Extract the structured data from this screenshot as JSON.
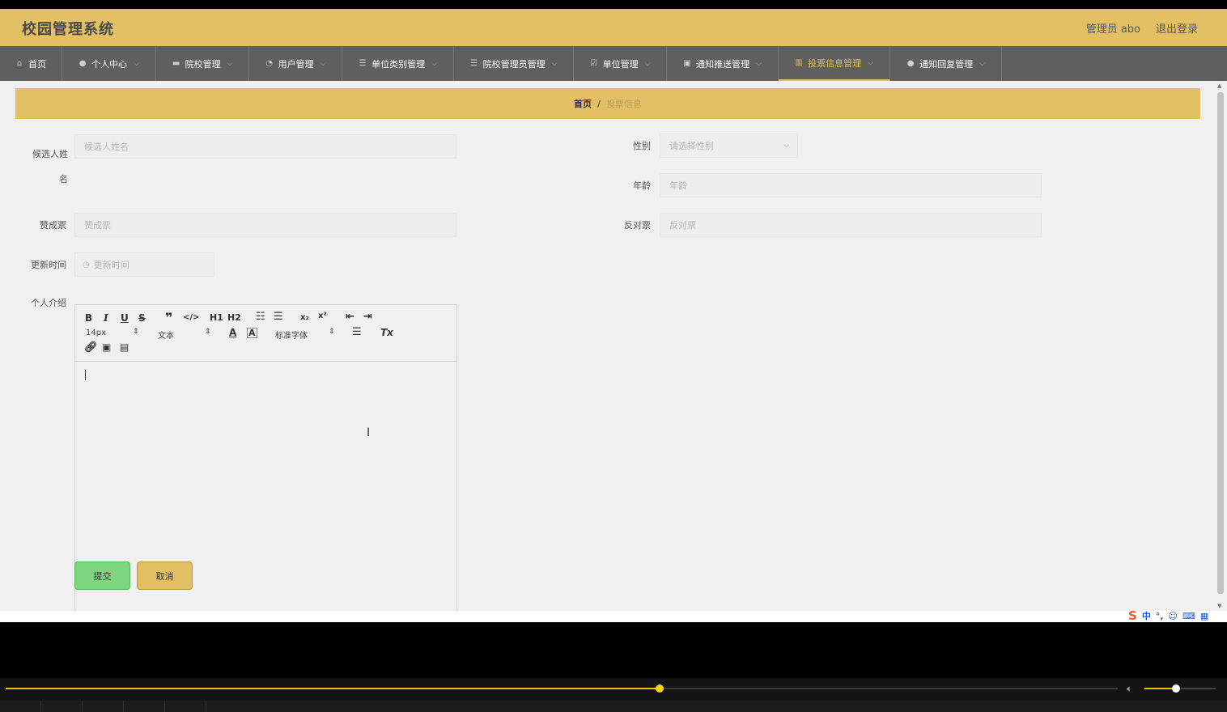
{
  "header": {
    "title": "校园管理系统",
    "user": "管理员 abo",
    "logout": "退出登录"
  },
  "nav": [
    {
      "label": "首页",
      "icon": "home-icon",
      "glyph": "⌂",
      "width": 77,
      "chevron": false
    },
    {
      "label": "个人中心",
      "icon": "user-icon",
      "glyph": "●",
      "width": 116,
      "chevron": true
    },
    {
      "label": "院校管理",
      "icon": "school-icon",
      "glyph": "▬",
      "width": 115,
      "chevron": true
    },
    {
      "label": "用户管理",
      "icon": "dashboard-icon",
      "glyph": "◔",
      "width": 115,
      "chevron": true
    },
    {
      "label": "单位类别管理",
      "icon": "list-icon",
      "glyph": "☰",
      "width": 138,
      "chevron": true
    },
    {
      "label": "院校管理员管理",
      "icon": "list-icon",
      "glyph": "☰",
      "width": 148,
      "chevron": true
    },
    {
      "label": "单位管理",
      "icon": "checkbox-icon",
      "glyph": "☑",
      "width": 115,
      "chevron": true
    },
    {
      "label": "通知推送管理",
      "icon": "briefcase-icon",
      "glyph": "▣",
      "width": 138,
      "chevron": true
    },
    {
      "label": "投票信息管理",
      "icon": "chart-icon",
      "glyph": "▥",
      "width": 138,
      "chevron": true,
      "active": true
    },
    {
      "label": "通知回复管理",
      "icon": "user-icon",
      "glyph": "●",
      "width": 138,
      "chevron": true
    }
  ],
  "breadcrumb": {
    "home": "首页",
    "sep": "/",
    "current": "投票信息"
  },
  "form": {
    "candidate_label": "候选人姓名",
    "candidate_placeholder": "候选人姓名",
    "gender_label": "性别",
    "gender_placeholder": "请选择性别",
    "age_label": "年龄",
    "age_placeholder": "年龄",
    "yes_label": "赞成票",
    "yes_placeholder": "赞成票",
    "no_label": "反对票",
    "no_placeholder": "反对票",
    "time_label": "更新时间",
    "time_placeholder": "更新时间",
    "intro_label": "个人介绍"
  },
  "editor": {
    "font_size": "14px",
    "text_type": "文本",
    "font_family": "标准字体"
  },
  "buttons": {
    "submit": "提交",
    "cancel": "取消"
  },
  "ime": {
    "zh": "中"
  },
  "player": {
    "progress": 0.588,
    "volume": 0.44
  },
  "colors": {
    "accent": "#e2c063",
    "nav_bg": "#5f5f5f",
    "submit": "#7dd67d"
  }
}
